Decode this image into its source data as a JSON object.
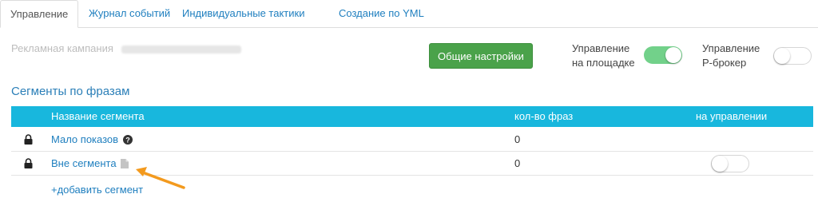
{
  "tabs": [
    {
      "label": "Управление",
      "active": true
    },
    {
      "label": "Журнал событий",
      "active": false
    },
    {
      "label": "Индивидуальные тактики",
      "active": false
    },
    {
      "label": "Создание по YML",
      "active": false
    }
  ],
  "campaign": {
    "label": "Рекламная кампания"
  },
  "settings_button": {
    "label": "Общие настройки"
  },
  "toggles": {
    "platform": {
      "line1": "Управление",
      "line2": "на площадке",
      "state": "on"
    },
    "broker": {
      "line1": "Управление",
      "line2": "Р-брокер",
      "state": "off"
    }
  },
  "section_title": "Сегменты по фразам",
  "table": {
    "headers": {
      "name": "Название сегмента",
      "count": "кол-во фраз",
      "managed": "на управлении"
    },
    "rows": [
      {
        "name": "Мало показов",
        "count": "0",
        "icon": "question-circle-icon"
      },
      {
        "name": "Вне сегмента",
        "count": "0",
        "icon": "file-icon"
      }
    ]
  },
  "add_segment": "+добавить сегмент",
  "colors": {
    "accent": "#18b7dd",
    "link": "#1f7fbf",
    "button": "#4aa24a",
    "toggle_on": "#72d18a"
  }
}
